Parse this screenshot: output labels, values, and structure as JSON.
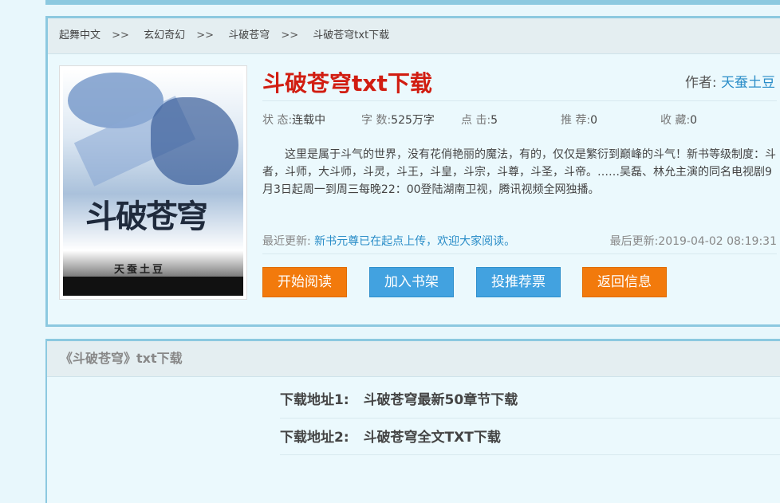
{
  "breadcrumb": [
    "起舞中文",
    "玄幻奇幻",
    "斗破苍穹",
    "斗破苍穹txt下载"
  ],
  "breadcrumb_separator": ">>",
  "cover": {
    "title": "斗破苍穹",
    "author_stamp": "天蚕土豆"
  },
  "book": {
    "title": "斗破苍穹txt下载",
    "author_label": "作者:",
    "author": "天蚕土豆"
  },
  "stats": {
    "status_label": "状 态:",
    "status": "连载中",
    "words_label": "字 数:",
    "words": "525万字",
    "clicks_label": "点 击:",
    "clicks": "5",
    "recommend_label": "推 荐:",
    "recommend": "0",
    "favorites_label": "收 藏:",
    "favorites": "0"
  },
  "description": "这里是属于斗气的世界，没有花俏艳丽的魔法，有的，仅仅是繁衍到巅峰的斗气！新书等级制度：斗者，斗师，大斗师，斗灵，斗王，斗皇，斗宗，斗尊，斗圣，斗帝。……吴磊、林允主演的同名电视剧9月3日起周一到周三每晚22：00登陆湖南卫视，腾讯视频全网独播。",
  "update": {
    "recent_label": "最近更新:",
    "recent": "新书元尊已在起点上传，欢迎大家阅读。",
    "last_label": "最后更新:",
    "last": "2019-04-02 08:19:31"
  },
  "buttons": {
    "start_reading": "开始阅读",
    "add_shelf": "加入书架",
    "vote": "投推荐票",
    "back": "返回信息"
  },
  "download": {
    "header": "《斗破苍穹》txt下载",
    "items": [
      {
        "label": "下载地址1:",
        "text": "斗破苍穹最新50章节下载"
      },
      {
        "label": "下载地址2:",
        "text": "斗破苍穹全文TXT下载"
      }
    ]
  },
  "colors": {
    "accent_blue": "#8cc9e0",
    "title_red": "#d11d11",
    "button_orange": "#f27a0c",
    "button_blue": "#42a2e0",
    "link_blue": "#2a8dc8"
  }
}
